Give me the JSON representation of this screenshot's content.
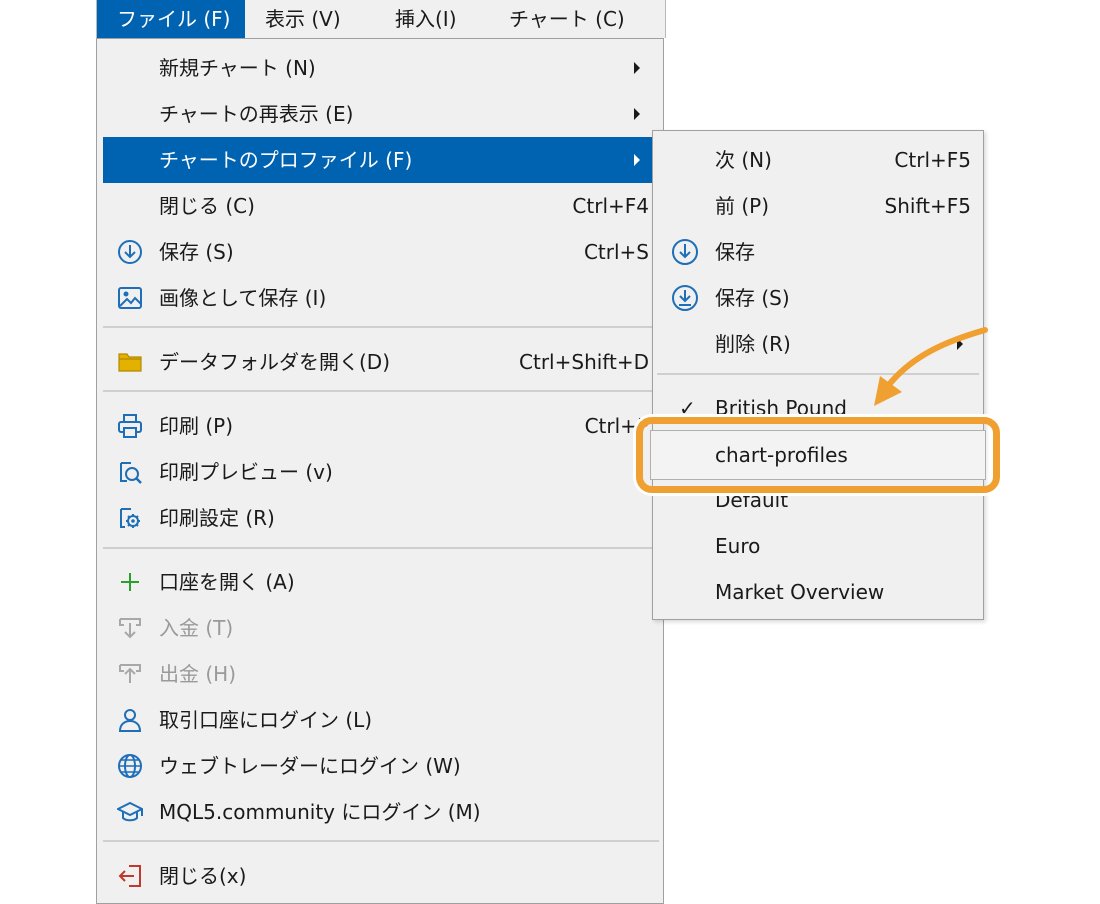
{
  "menubar": {
    "items": [
      {
        "label": "ファイル (F)"
      },
      {
        "label": "表示 (V)"
      },
      {
        "label": "挿入(I)"
      },
      {
        "label": "チャート (C)"
      }
    ]
  },
  "file_menu": {
    "items": [
      {
        "label": "新規チャート (N)",
        "shortcut": ""
      },
      {
        "label": "チャートの再表示 (E)",
        "shortcut": ""
      },
      {
        "label": "チャートのプロファイル (F)",
        "shortcut": ""
      },
      {
        "label": "閉じる (C)",
        "shortcut": "Ctrl+F4"
      },
      {
        "label": "保存 (S)",
        "shortcut": "Ctrl+S"
      },
      {
        "label": "画像として保存 (I)",
        "shortcut": ""
      },
      {
        "label": "データフォルダを開く(D)",
        "shortcut": "Ctrl+Shift+D"
      },
      {
        "label": "印刷 (P)",
        "shortcut": "Ctrl+P"
      },
      {
        "label": "印刷プレビュー (v)",
        "shortcut": ""
      },
      {
        "label": "印刷設定 (R)",
        "shortcut": ""
      },
      {
        "label": "口座を開く (A)",
        "shortcut": ""
      },
      {
        "label": "入金 (T)",
        "shortcut": ""
      },
      {
        "label": "出金 (H)",
        "shortcut": ""
      },
      {
        "label": "取引口座にログイン (L)",
        "shortcut": ""
      },
      {
        "label": "ウェブトレーダーにログイン (W)",
        "shortcut": ""
      },
      {
        "label": "MQL5.community にログイン (M)",
        "shortcut": ""
      },
      {
        "label": "閉じる(x)",
        "shortcut": ""
      }
    ]
  },
  "profile_submenu": {
    "items": [
      {
        "label": "次 (N)",
        "shortcut": "Ctrl+F5"
      },
      {
        "label": "前 (P)",
        "shortcut": "Shift+F5"
      },
      {
        "label": "保存",
        "shortcut": ""
      },
      {
        "label": "保存 (S)",
        "shortcut": ""
      },
      {
        "label": "削除 (R)",
        "shortcut": ""
      }
    ],
    "profiles": [
      {
        "label": "British Pound",
        "checked": "✓"
      },
      {
        "label": "chart-profiles"
      },
      {
        "label": "Default"
      },
      {
        "label": "Euro"
      },
      {
        "label": "Market Overview"
      }
    ]
  },
  "colors": {
    "highlight": "#0063b1",
    "callout": "#f0a030",
    "icon_blue": "#1e6fb8",
    "icon_green": "#2aa02a",
    "icon_red": "#c0392b",
    "folder": "#e3b100"
  }
}
